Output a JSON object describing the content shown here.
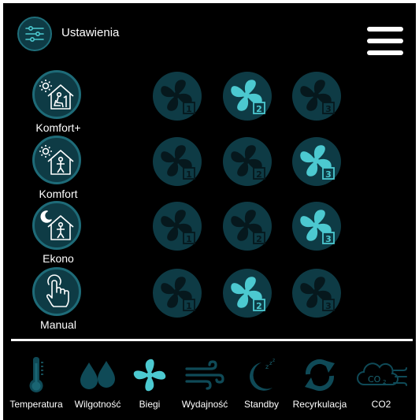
{
  "header": {
    "settings_label": "Ustawienia",
    "settings_icon": "sliders-icon",
    "menu_icon": "hamburger-menu-icon"
  },
  "modes": [
    {
      "label": "Komfort+",
      "icon": "house-sun-relax-icon",
      "active_speed": 2
    },
    {
      "label": "Komfort",
      "icon": "house-sun-person-icon",
      "active_speed": 3
    },
    {
      "label": "Ekono",
      "icon": "house-moon-person-icon",
      "active_speed": 3
    },
    {
      "label": "Manual",
      "icon": "hand-tap-icon",
      "active_speed": 2
    }
  ],
  "fan_speeds": [
    "1",
    "2",
    "3"
  ],
  "bottom_nav": [
    {
      "label": "Temperatura",
      "icon": "thermometer-icon"
    },
    {
      "label": "Wilgotność",
      "icon": "water-drops-icon"
    },
    {
      "label": "Biegi",
      "icon": "fan-icon"
    },
    {
      "label": "Wydajność",
      "icon": "wind-icon"
    },
    {
      "label": "Standby",
      "icon": "moon-sleep-icon"
    },
    {
      "label": "Recyrkulacja",
      "icon": "recirculation-icon"
    },
    {
      "label": "CO2",
      "icon": "co2-cloud-icon"
    }
  ],
  "colors": {
    "accent": "#4cc9d0",
    "button_bg": "#0e3b45",
    "inactive_icon": "#06181d",
    "nav_icon": "#0f4a57"
  }
}
